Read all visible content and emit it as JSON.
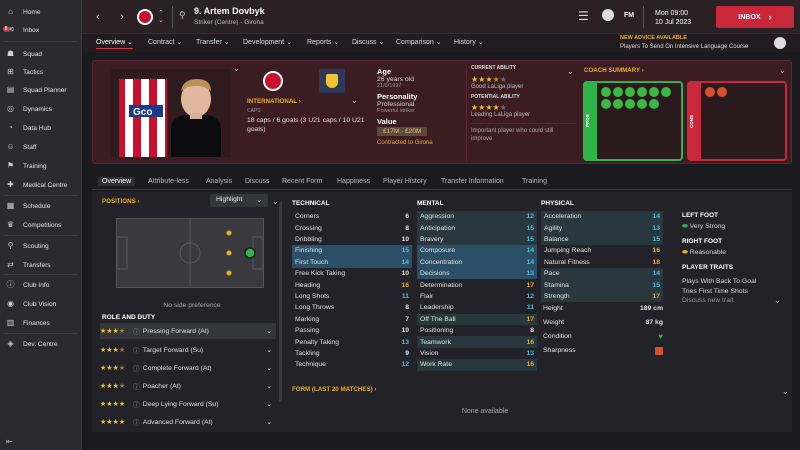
{
  "sidebar": {
    "items": [
      {
        "label": "Home",
        "icon": "home-icon"
      },
      {
        "label": "Inbox",
        "icon": "inbox-icon",
        "badge": "8"
      },
      {
        "label": "Squad",
        "icon": "squad-icon"
      },
      {
        "label": "Tactics",
        "icon": "tactics-icon"
      },
      {
        "label": "Squad Planner",
        "icon": "planner-icon"
      },
      {
        "label": "Dynamics",
        "icon": "dynamics-icon"
      },
      {
        "label": "Data Hub",
        "icon": "data-hub-icon"
      },
      {
        "label": "Staff",
        "icon": "staff-icon"
      },
      {
        "label": "Training",
        "icon": "training-icon"
      },
      {
        "label": "Medical Centre",
        "icon": "medical-icon"
      },
      {
        "label": "Schedule",
        "icon": "schedule-icon"
      },
      {
        "label": "Competitions",
        "icon": "competitions-icon"
      },
      {
        "label": "Scouting",
        "icon": "scouting-icon"
      },
      {
        "label": "Transfers",
        "icon": "transfers-icon"
      },
      {
        "label": "Club Info",
        "icon": "club-info-icon"
      },
      {
        "label": "Club Vision",
        "icon": "club-vision-icon"
      },
      {
        "label": "Finances",
        "icon": "finances-icon"
      },
      {
        "label": "Dev. Centre",
        "icon": "dev-centre-icon"
      }
    ]
  },
  "header": {
    "player_name": "9. Artem Dovbyk",
    "player_sub": "Striker (Centre) - Girona",
    "day_time": "Mon 09:00",
    "date": "10 Jul 2023",
    "inbox_label": "INBOX",
    "advice_title": "NEW ADVICE AVAILABLE",
    "advice_text": "Players To Send On Intensive Language Course",
    "fm_label": "FM"
  },
  "subnav": [
    "Overview",
    "Contract",
    "Transfer",
    "Development",
    "Reports",
    "Discuss",
    "Comparison",
    "History"
  ],
  "profile": {
    "international_label": "INTERNATIONAL",
    "caps_label": "CAPS",
    "caps_text": "18 caps / 6 goals (3 U21 caps / 10 U21 goals)",
    "age_label": "Age",
    "age": "26 years old",
    "dob": "21/6/1997",
    "personality_label": "Personality",
    "personality": "Professional",
    "personality_sub": "Powerful striker",
    "value_label": "Value",
    "value": "£17M - £20M",
    "contract": "Contracted to Girona",
    "current_ability_label": "CURRENT ABILITY",
    "current_ability_text": "Good LaLiga player",
    "current_ability_stars": 3.5,
    "potential_ability_label": "POTENTIAL ABILITY",
    "potential_ability_text": "Leading LaLiga player",
    "potential_ability_stars": 4,
    "potential_note": "Important player who could still improve",
    "coach_summary_label": "COACH SUMMARY",
    "pros_label": "PROS",
    "cons_label": "CONS",
    "shirt_sponsor": "Gco"
  },
  "tabs": [
    "Overview",
    "Attribute-less",
    "Analysis",
    "Discuss",
    "Recent Form",
    "Happiness",
    "Player History",
    "Transfer Information",
    "Training"
  ],
  "positions": {
    "label": "POSITIONS",
    "highlight_label": "Highlight",
    "no_side": "No side preference"
  },
  "roles": {
    "label": "ROLE AND DUTY",
    "items": [
      {
        "name": "Pressing Forward (At)",
        "stars": 3.5
      },
      {
        "name": "Target Forward (Su)",
        "stars": 3.5
      },
      {
        "name": "Complete Forward (At)",
        "stars": 3.5
      },
      {
        "name": "Poacher (At)",
        "stars": 3.5
      },
      {
        "name": "Deep Lying Forward (Su)",
        "stars": 3
      },
      {
        "name": "Advanced Forward (At)",
        "stars": 3
      }
    ]
  },
  "technical": {
    "label": "TECHNICAL",
    "rows": [
      {
        "name": "Corners",
        "value": "6"
      },
      {
        "name": "Crossing",
        "value": "8"
      },
      {
        "name": "Dribbling",
        "value": "10"
      },
      {
        "name": "Finishing",
        "value": "15"
      },
      {
        "name": "First Touch",
        "value": "14"
      },
      {
        "name": "Free Kick Taking",
        "value": "10"
      },
      {
        "name": "Heading",
        "value": "16"
      },
      {
        "name": "Long Shots",
        "value": "11"
      },
      {
        "name": "Long Throws",
        "value": "8"
      },
      {
        "name": "Marking",
        "value": "7"
      },
      {
        "name": "Passing",
        "value": "10"
      },
      {
        "name": "Penalty Taking",
        "value": "13"
      },
      {
        "name": "Tackling",
        "value": "9"
      },
      {
        "name": "Technique",
        "value": "12"
      }
    ]
  },
  "mental": {
    "label": "MENTAL",
    "rows": [
      {
        "name": "Aggression",
        "value": "12"
      },
      {
        "name": "Anticipation",
        "value": "15"
      },
      {
        "name": "Bravery",
        "value": "15"
      },
      {
        "name": "Composure",
        "value": "14"
      },
      {
        "name": "Concentration",
        "value": "14"
      },
      {
        "name": "Decisions",
        "value": "13"
      },
      {
        "name": "Determination",
        "value": "17"
      },
      {
        "name": "Flair",
        "value": "12"
      },
      {
        "name": "Leadership",
        "value": "11"
      },
      {
        "name": "Off The Ball",
        "value": "17"
      },
      {
        "name": "Positioning",
        "value": "8"
      },
      {
        "name": "Teamwork",
        "value": "16"
      },
      {
        "name": "Vision",
        "value": "13"
      },
      {
        "name": "Work Rate",
        "value": "16"
      }
    ]
  },
  "physical": {
    "label": "PHYSICAL",
    "rows": [
      {
        "name": "Acceleration",
        "value": "14"
      },
      {
        "name": "Agility",
        "value": "13"
      },
      {
        "name": "Balance",
        "value": "15"
      },
      {
        "name": "Jumping Reach",
        "value": "16"
      },
      {
        "name": "Natural Fitness",
        "value": "18"
      },
      {
        "name": "Pace",
        "value": "14"
      },
      {
        "name": "Stamina",
        "value": "15"
      },
      {
        "name": "Strength",
        "value": "17"
      }
    ],
    "height_label": "Height",
    "height": "189 cm",
    "weight_label": "Weight",
    "weight": "87 kg",
    "condition_label": "Condition",
    "sharpness_label": "Sharpness"
  },
  "feet": {
    "left_label": "LEFT FOOT",
    "left": "Very Strong",
    "right_label": "RIGHT FOOT",
    "right": "Reasonable"
  },
  "traits": {
    "label": "PLAYER TRAITS",
    "items": [
      "Plays With Back To Goal",
      "Tries First Time Shots"
    ],
    "discuss": "Discuss new trait"
  },
  "form": {
    "label": "FORM (LAST 20 MATCHES)",
    "empty": "None available"
  },
  "colors": {
    "accent": "#c8283a",
    "highlight": "#2c4f68",
    "good": "#7ed957",
    "gold": "#e8b020"
  }
}
